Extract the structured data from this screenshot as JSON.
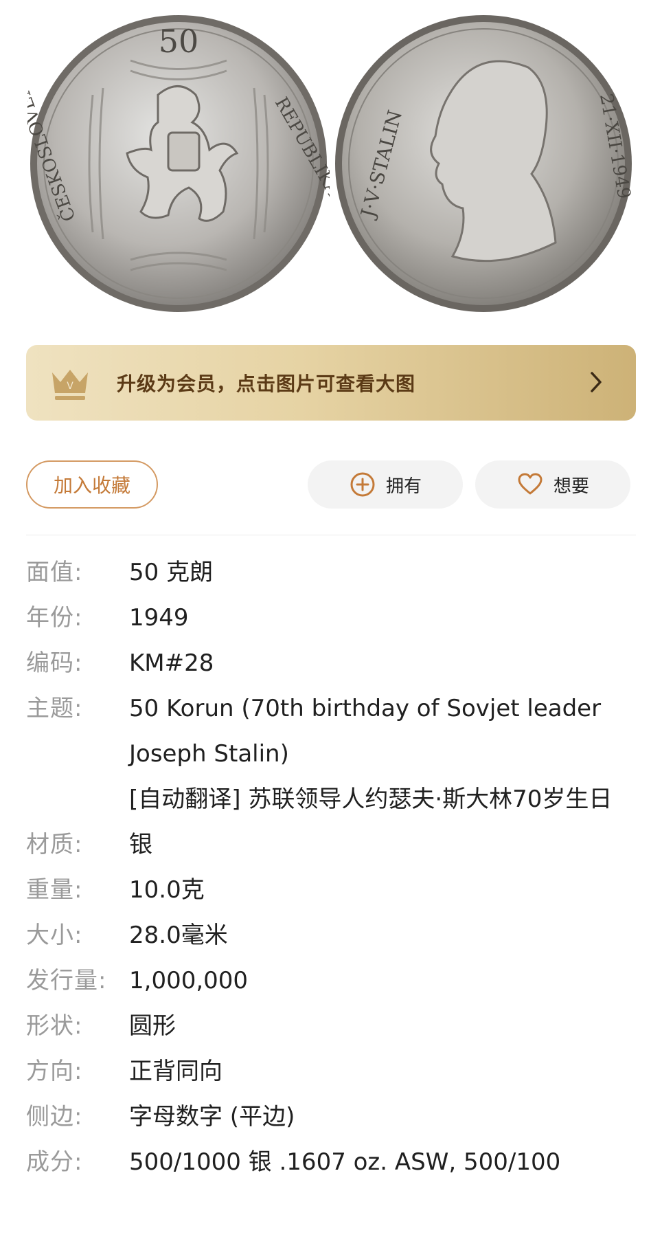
{
  "banner": {
    "text": "升级为会员，点击图片可查看大图"
  },
  "actions": {
    "favorite_label": "加入收藏",
    "own_label": "拥有",
    "want_label": "想要"
  },
  "coin": {
    "obverse_denomination": "50",
    "obverse_legend_right": "REPUBLIKA",
    "obverse_legend_left": "ČESKOSLOVENSKÁ",
    "reverse_name": "J·V·STALIN",
    "reverse_date": "21·XII·1949"
  },
  "details": [
    {
      "key": "面值:",
      "value": "50 克朗"
    },
    {
      "key": "年份:",
      "value": "1949"
    },
    {
      "key": "编码:",
      "value": "KM#28"
    },
    {
      "key": "主题:",
      "value": "50 Korun (70th birthday of Sovjet leader Joseph Stalin)",
      "value2": "[自动翻译] 苏联领导人约瑟夫·斯大林70岁生日"
    },
    {
      "key": "材质:",
      "value": "银"
    },
    {
      "key": "重量:",
      "value": "10.0克"
    },
    {
      "key": "大小:",
      "value": "28.0毫米"
    },
    {
      "key": "发行量:",
      "value": "1,000,000"
    },
    {
      "key": "形状:",
      "value": "圆形"
    },
    {
      "key": "方向:",
      "value": "正背同向"
    },
    {
      "key": "侧边:",
      "value": "字母数字 (平边)"
    },
    {
      "key": "成分:",
      "value": "500/1000 银 .1607 oz. ASW, 500/100"
    }
  ],
  "colors": {
    "accent": "#c47a38",
    "banner_text": "#5b3a16",
    "label_gray": "#9a9a9a"
  }
}
